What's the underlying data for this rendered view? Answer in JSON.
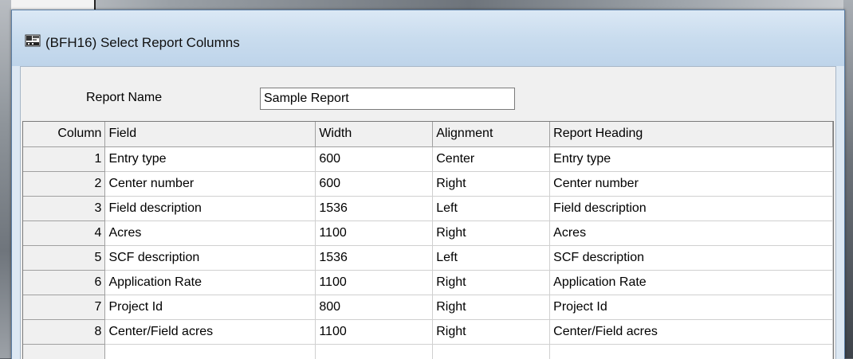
{
  "window": {
    "title": "(BFH16)  Select Report Columns",
    "icon": "app-icon"
  },
  "form": {
    "report_name_label": "Report Name",
    "report_name_value": "Sample Report"
  },
  "grid": {
    "columns": [
      "Column",
      "Field",
      "Width",
      "Alignment",
      "Report Heading"
    ],
    "rows": [
      {
        "num": "1",
        "field": "Entry type",
        "width": "600",
        "alignment": "Center",
        "heading": "Entry type"
      },
      {
        "num": "2",
        "field": "Center number",
        "width": "600",
        "alignment": "Right",
        "heading": "Center number"
      },
      {
        "num": "3",
        "field": "Field description",
        "width": "1536",
        "alignment": "Left",
        "heading": "Field description"
      },
      {
        "num": "4",
        "field": "Acres",
        "width": "1100",
        "alignment": "Right",
        "heading": "Acres"
      },
      {
        "num": "5",
        "field": "SCF description",
        "width": "1536",
        "alignment": "Left",
        "heading": "SCF description"
      },
      {
        "num": "6",
        "field": "Application Rate",
        "width": "1100",
        "alignment": "Right",
        "heading": "Application Rate"
      },
      {
        "num": "7",
        "field": "Project Id",
        "width": "800",
        "alignment": "Right",
        "heading": "Project Id"
      },
      {
        "num": "8",
        "field": "Center/Field acres",
        "width": "1100",
        "alignment": "Right",
        "heading": "Center/Field acres"
      }
    ]
  }
}
